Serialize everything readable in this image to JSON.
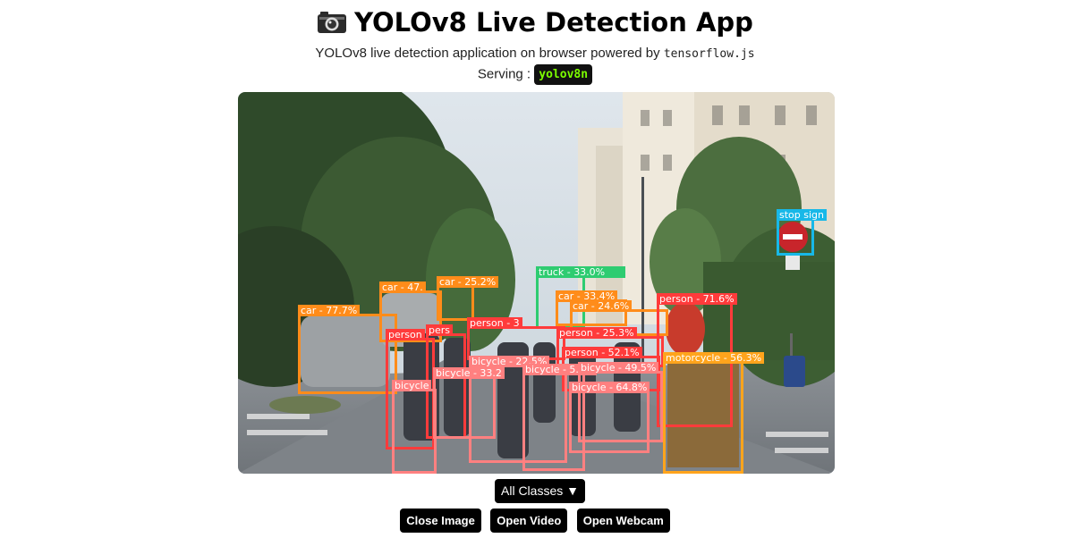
{
  "app": {
    "title": "YOLOv8 Live Detection App",
    "camera_icon": "camera-icon",
    "subtitle_prefix": "YOLOv8 live detection application on browser powered by",
    "subtitle_code": "tensorflow.js",
    "serving_label": "Serving :",
    "model_name": "yolov8n"
  },
  "controls": {
    "class_filter": "All Classes ▼",
    "close_image": "Close Image",
    "open_video": "Open Video",
    "open_webcam": "Open Webcam"
  },
  "detections": [
    {
      "label": "stop sign",
      "color": "#17b8e8"
    },
    {
      "label": "truck - 33.0%",
      "color": "#2ecc71"
    },
    {
      "label": "car - 47.",
      "color": "#ff8c1a"
    },
    {
      "label": "car - 25.2%",
      "color": "#ff8c1a"
    },
    {
      "label": "car - 77.7%",
      "color": "#ff8c1a"
    },
    {
      "label": "car - 33.4%",
      "color": "#ff8c1a"
    },
    {
      "label": "car - 24.6%",
      "color": "#ff8c1a"
    },
    {
      "label": "person - 71.6%",
      "color": "#ff3b3b"
    },
    {
      "label": "person - 3",
      "color": "#ff3b3b"
    },
    {
      "label": "person - 25.3%",
      "color": "#ff3b3b"
    },
    {
      "label": "person - 52.1%",
      "color": "#ff3b3b"
    },
    {
      "label": "person",
      "color": "#ff3b3b"
    },
    {
      "label": "pers",
      "color": "#ff3b3b"
    },
    {
      "label": "motorcycle - 56.3%",
      "color": "#ffa41c"
    },
    {
      "label": "bicycle - 22.5%",
      "color": "#ff8080"
    },
    {
      "label": "bicycle - 33.2",
      "color": "#ff8080"
    },
    {
      "label": "bicycle - 5.7%",
      "color": "#ff8080"
    },
    {
      "label": "bicycle - 49.5%",
      "color": "#ff8080"
    },
    {
      "label": "bicycle - 64.8%",
      "color": "#ff8080"
    },
    {
      "label": "bicycle",
      "color": "#ff8080"
    }
  ]
}
